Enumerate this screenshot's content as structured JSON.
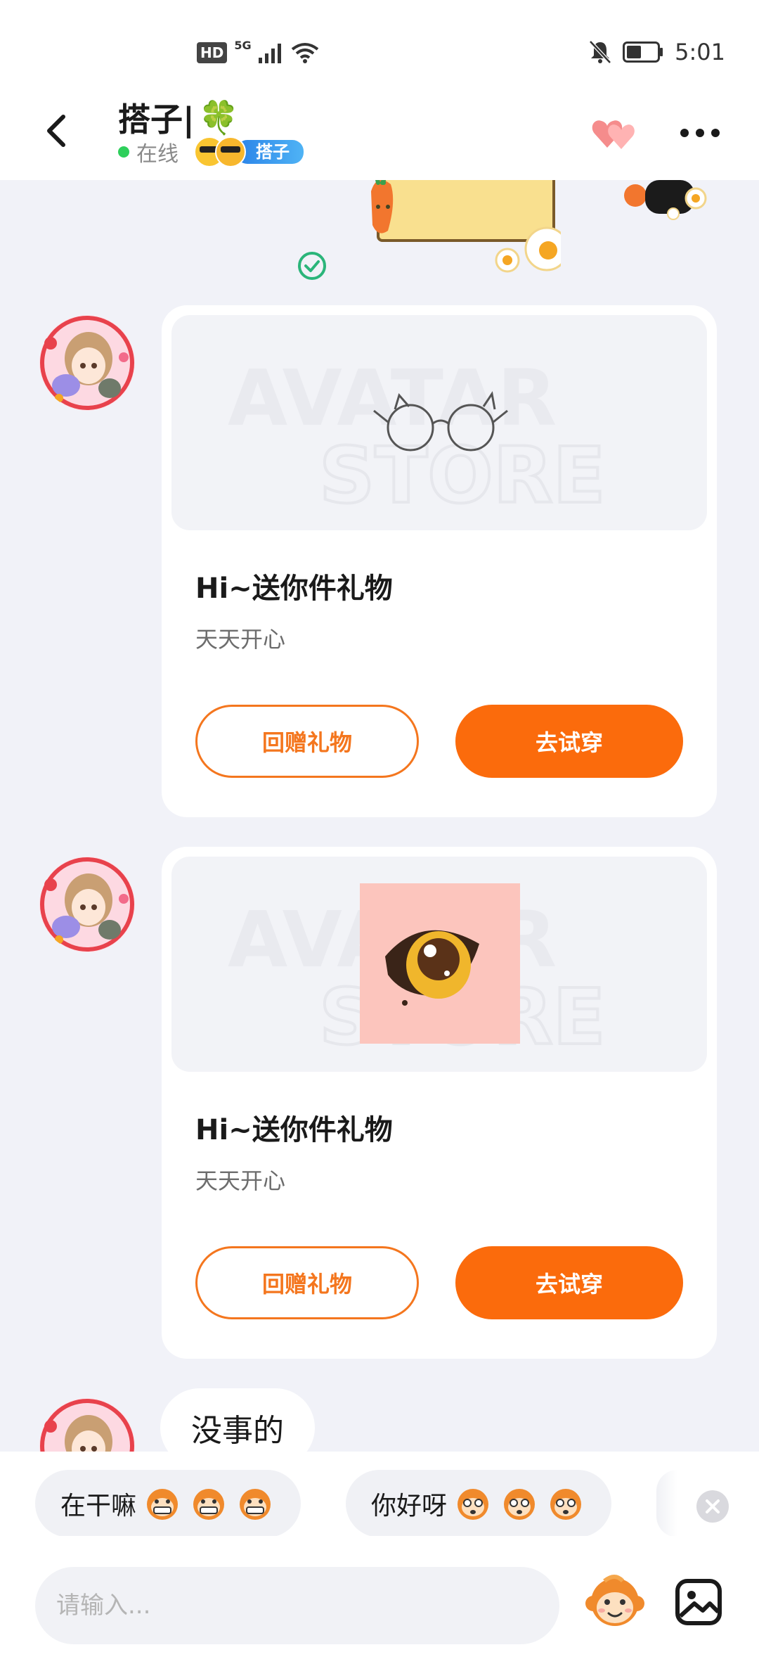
{
  "status_bar": {
    "hd": "HD",
    "network": "5G",
    "time": "5:01",
    "battery_level": 0.5
  },
  "header": {
    "contact_name": "搭子|",
    "contact_emoji": "🍀",
    "presence": "在线",
    "tag": "搭子"
  },
  "messages": [
    {
      "type": "gift",
      "item_icon": "cat-ear-glasses-icon",
      "title": "Hi~送你件礼物",
      "subtitle": "天天开心",
      "return_label": "回赠礼物",
      "try_label": "去试穿"
    },
    {
      "type": "gift",
      "item_icon": "anime-eye-icon",
      "title": "Hi~送你件礼物",
      "subtitle": "天天开心",
      "return_label": "回赠礼物",
      "try_label": "去试穿"
    },
    {
      "type": "text",
      "text": "没事的"
    }
  ],
  "quick_replies": [
    {
      "text": "在干嘛",
      "emoji": "grinning-monkey-icon"
    },
    {
      "text": "你好呀",
      "emoji": "surprised-monkey-icon"
    }
  ],
  "input": {
    "placeholder": "请输入..."
  },
  "colors": {
    "accent": "#fb6b0c",
    "online": "#2ecf5b",
    "tag": "#2a83e8",
    "background": "#f1f2f8"
  }
}
